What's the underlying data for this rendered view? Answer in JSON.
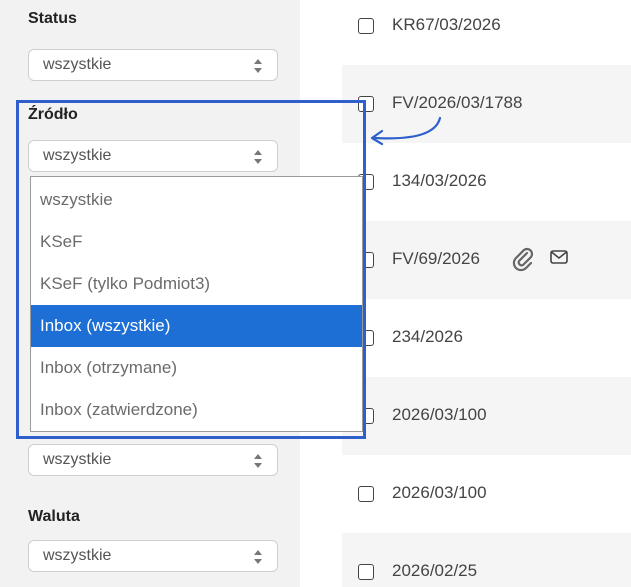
{
  "filters": {
    "status": {
      "label": "Status",
      "value": "wszystkie"
    },
    "zrodlo": {
      "label": "Źródło",
      "value": "wszystkie"
    },
    "hidden_filter": {
      "value": "wszystkie"
    },
    "waluta": {
      "label": "Waluta",
      "value": "wszystkie"
    }
  },
  "dropdown": {
    "options": [
      "wszystkie",
      "KSeF",
      "KSeF (tylko Podmiot3)",
      "Inbox (wszystkie)",
      "Inbox (otrzymane)",
      "Inbox (zatwierdzone)"
    ],
    "selected_index": 3
  },
  "documents": [
    "KR67/03/2026",
    "FV/2026/03/1788",
    "134/03/2026",
    "FV/69/2026",
    "234/2026",
    "2026/03/100",
    "2026/03/100",
    "2026/02/25"
  ],
  "colors": {
    "highlight": "#2f5fcb",
    "selected_option": "#1d6fd6"
  }
}
